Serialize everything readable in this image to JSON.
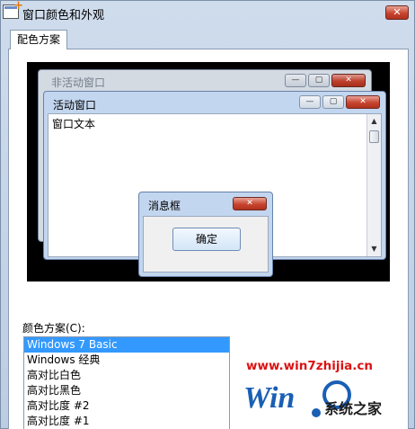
{
  "window": {
    "title": "窗口颜色和外观",
    "close_label": "✕"
  },
  "tab": {
    "label": "配色方案"
  },
  "preview": {
    "inactive_window_title": "非活动窗口",
    "active_window_title": "活动窗口",
    "window_text": "窗口文本",
    "message_box_title": "消息框",
    "ok_button": "确定",
    "minimize_glyph": "—",
    "maximize_glyph": "▢",
    "close_glyph": "✕"
  },
  "color_scheme": {
    "label": "颜色方案(C):",
    "items": [
      {
        "label": "Windows 7 Basic",
        "selected": true
      },
      {
        "label": "Windows 经典",
        "selected": false
      },
      {
        "label": "高对比白色",
        "selected": false
      },
      {
        "label": "高对比黑色",
        "selected": false
      },
      {
        "label": "高对比度 #2",
        "selected": false
      },
      {
        "label": "高对比度 #1",
        "selected": false
      }
    ]
  },
  "watermark": {
    "url": "www.win7zhijia.cn",
    "brand": "系统之家",
    "colors": {
      "url": "#dd1111",
      "logo_blue": "#1a5fb4"
    }
  },
  "colors": {
    "selection": "#3399ff",
    "title_close": "#c8452f",
    "preview_bg": "#000000"
  }
}
